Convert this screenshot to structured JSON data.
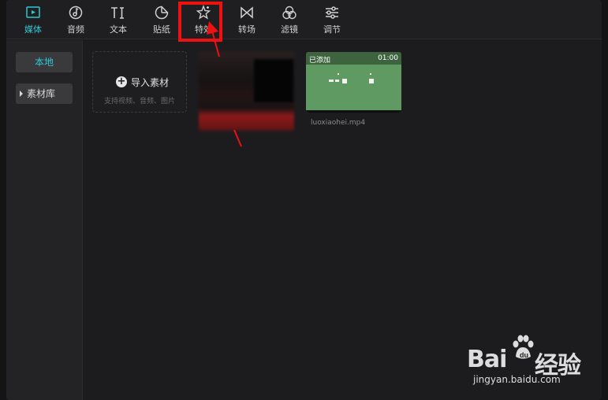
{
  "toolbar": {
    "tabs": [
      {
        "label": "媒体",
        "icon": "media-icon",
        "active": true
      },
      {
        "label": "音频",
        "icon": "audio-icon",
        "active": false
      },
      {
        "label": "文本",
        "icon": "text-icon",
        "active": false
      },
      {
        "label": "贴纸",
        "icon": "sticker-icon",
        "active": false
      },
      {
        "label": "特效",
        "icon": "effects-icon",
        "active": false
      },
      {
        "label": "转场",
        "icon": "transition-icon",
        "active": false
      },
      {
        "label": "滤镜",
        "icon": "filter-icon",
        "active": false
      },
      {
        "label": "调节",
        "icon": "adjust-icon",
        "active": false
      }
    ]
  },
  "sidebar": {
    "local": "本地",
    "library": "素材库"
  },
  "import": {
    "label": "导入素材",
    "hint": "支持视频、音频、图片"
  },
  "clip": {
    "status": "已添加",
    "duration": "01:00",
    "filename": "luoxiaohei.mp4"
  },
  "watermark": {
    "brand": "Bai",
    "brand2": "经验",
    "url": "jingyan.baidu.com"
  },
  "colors": {
    "accent": "#2fc7d4",
    "highlight": "#ee1111",
    "clip_bg": "#5e9a62"
  }
}
